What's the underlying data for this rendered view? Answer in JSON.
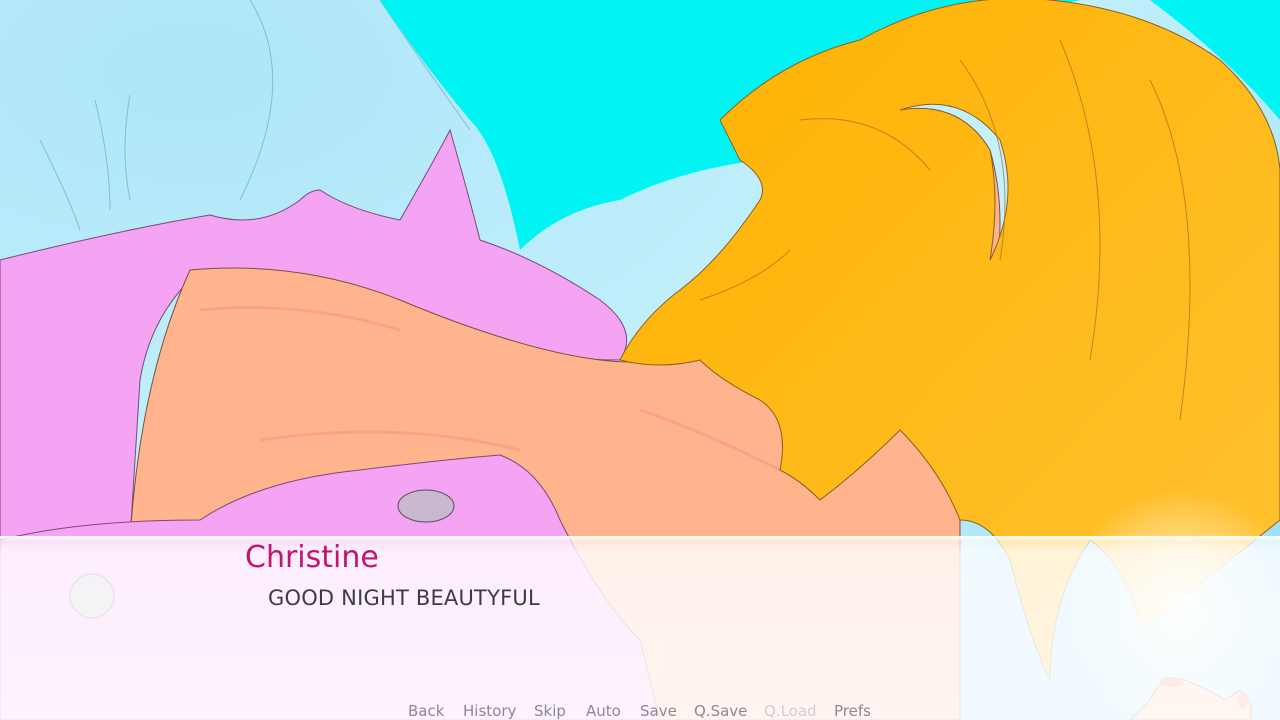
{
  "dialogue": {
    "speaker": "Christine",
    "text": "GOOD NIGHT BEAUTYFUL"
  },
  "quick_menu": {
    "back": "Back",
    "history": "History",
    "skip": "Skip",
    "auto": "Auto",
    "save": "Save",
    "qsave": "Q.Save",
    "qload": "Q.Load",
    "prefs": "Prefs"
  },
  "colors": {
    "speaker_name": "#c0166e",
    "dialogue_text": "#3c3c46",
    "menu_text": "#8a8a94",
    "menu_disabled": "#cfcfd4",
    "sky": "#bfeefb",
    "cyan": "#00f4f4",
    "hair": "#ffb800",
    "skin": "#ffb48e",
    "shirt": "#f4a4f2"
  }
}
